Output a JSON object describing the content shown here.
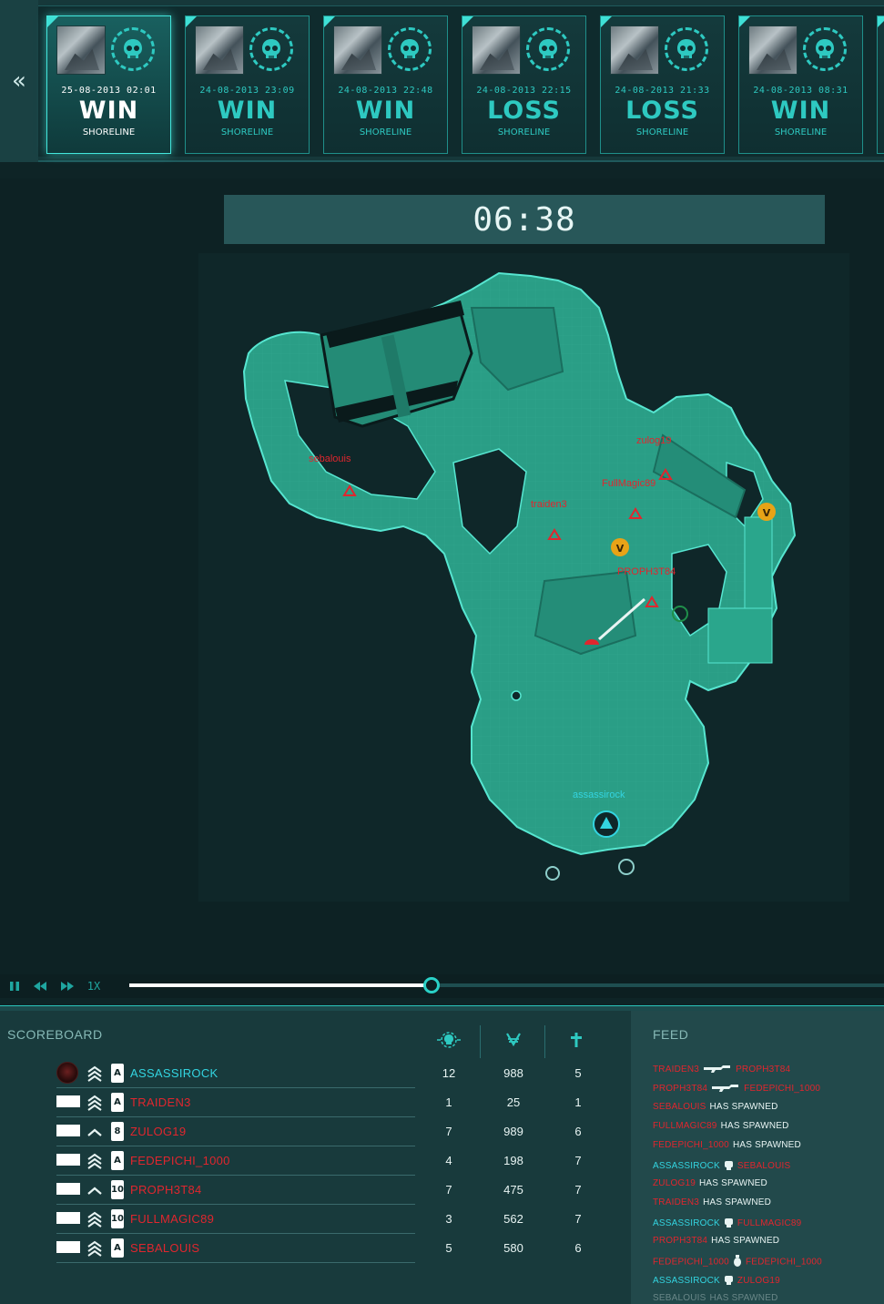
{
  "nav": {
    "back_label": "«"
  },
  "matches": [
    {
      "date": "25-08-2013 02:01",
      "result": "WIN",
      "map": "SHORELINE",
      "active": true
    },
    {
      "date": "24-08-2013 23:09",
      "result": "WIN",
      "map": "SHORELINE",
      "active": false
    },
    {
      "date": "24-08-2013 22:48",
      "result": "WIN",
      "map": "SHORELINE",
      "active": false
    },
    {
      "date": "24-08-2013 22:15",
      "result": "LOSS",
      "map": "SHORELINE",
      "active": false
    },
    {
      "date": "24-08-2013 21:33",
      "result": "LOSS",
      "map": "SHORELINE",
      "active": false
    },
    {
      "date": "24-08-2013 08:31",
      "result": "WIN",
      "map": "SHORELINE",
      "active": false
    }
  ],
  "replay": {
    "timer": "06:38",
    "speed": "1X",
    "progress": 0.4,
    "map_labels": [
      {
        "name": "sebalouis",
        "team": "red"
      },
      {
        "name": "zulog19",
        "team": "red"
      },
      {
        "name": "FullMagic89",
        "team": "red"
      },
      {
        "name": "traiden3",
        "team": "red"
      },
      {
        "name": "PROPH3T84",
        "team": "red"
      },
      {
        "name": "assassirock",
        "team": "blue"
      }
    ]
  },
  "scoreboard": {
    "title": "SCOREBOARD",
    "columns": [
      "kills-icon",
      "currency-icon",
      "deaths-icon"
    ],
    "rows": [
      {
        "name": "ASSASSIROCK",
        "team": "blue",
        "card": "A",
        "kills": "12",
        "money": "988",
        "deaths": "5"
      },
      {
        "name": "TRAIDEN3",
        "team": "red",
        "card": "A",
        "kills": "1",
        "money": "25",
        "deaths": "1"
      },
      {
        "name": "ZULOG19",
        "team": "red",
        "card": "8",
        "kills": "7",
        "money": "989",
        "deaths": "6"
      },
      {
        "name": "FEDEPICHI_1000",
        "team": "red",
        "card": "A",
        "kills": "4",
        "money": "198",
        "deaths": "7"
      },
      {
        "name": "PROPH3T84",
        "team": "red",
        "card": "10",
        "kills": "7",
        "money": "475",
        "deaths": "7"
      },
      {
        "name": "FULLMAGIC89",
        "team": "red",
        "card": "10",
        "kills": "3",
        "money": "562",
        "deaths": "7"
      },
      {
        "name": "SEBALOUIS",
        "team": "red",
        "card": "A",
        "kills": "5",
        "money": "580",
        "deaths": "6"
      }
    ]
  },
  "feed": {
    "title": "FEED",
    "spawn_text": "HAS SPAWNED",
    "events": [
      {
        "type": "kill",
        "actor": "TRAIDEN3",
        "actor_team": "red",
        "icon": "rifle-icon",
        "target": "PROPH3T84",
        "target_team": "red"
      },
      {
        "type": "kill",
        "actor": "PROPH3T84",
        "actor_team": "red",
        "icon": "rifle-icon",
        "target": "FEDEPICHI_1000",
        "target_team": "red"
      },
      {
        "type": "spawn",
        "actor": "SEBALOUIS",
        "actor_team": "red"
      },
      {
        "type": "spawn",
        "actor": "FULLMAGIC89",
        "actor_team": "red"
      },
      {
        "type": "spawn",
        "actor": "FEDEPICHI_1000",
        "actor_team": "red"
      },
      {
        "type": "kill",
        "actor": "ASSASSIROCK",
        "actor_team": "blue",
        "icon": "fist-icon",
        "target": "SEBALOUIS",
        "target_team": "red"
      },
      {
        "type": "spawn",
        "actor": "ZULOG19",
        "actor_team": "red"
      },
      {
        "type": "spawn",
        "actor": "TRAIDEN3",
        "actor_team": "red"
      },
      {
        "type": "kill",
        "actor": "ASSASSIROCK",
        "actor_team": "blue",
        "icon": "fist-icon",
        "target": "FULLMAGIC89",
        "target_team": "red"
      },
      {
        "type": "spawn",
        "actor": "PROPH3T84",
        "actor_team": "red"
      },
      {
        "type": "kill",
        "actor": "FEDEPICHI_1000",
        "actor_team": "red",
        "icon": "grenade-icon",
        "target": "FEDEPICHI_1000",
        "target_team": "red"
      },
      {
        "type": "kill",
        "actor": "ASSASSIROCK",
        "actor_team": "blue",
        "icon": "fist-icon",
        "target": "ZULOG19",
        "target_team": "red"
      },
      {
        "type": "spawn",
        "actor": "SEBALOUIS",
        "actor_team": "white"
      }
    ]
  },
  "colors": {
    "accent": "#2ec9c1",
    "red_team": "#e0262e",
    "blue_team": "#33d4e0",
    "terrain": "#2a9e86"
  }
}
